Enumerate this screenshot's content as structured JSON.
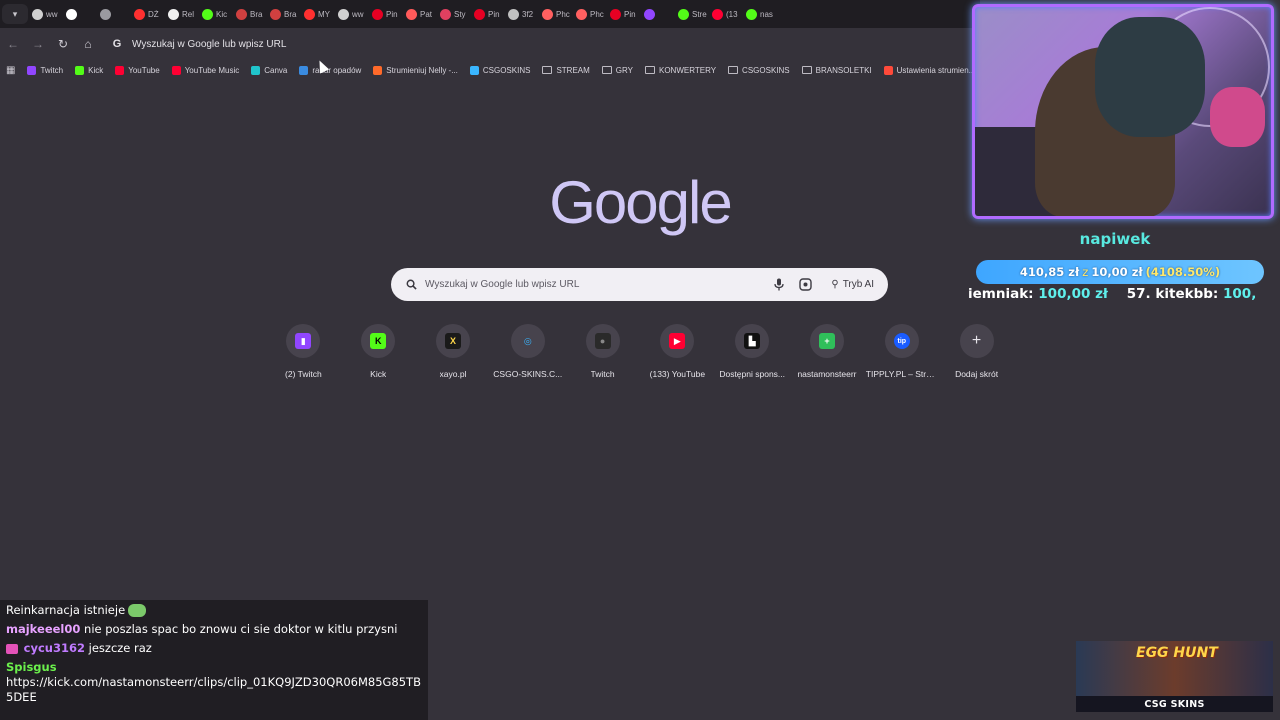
{
  "tabs": [
    {
      "label": "ww",
      "fav": "#d0d0d0"
    },
    {
      "label": "",
      "fav": "#ffffff"
    },
    {
      "label": "",
      "fav": "#9a9aa0"
    },
    {
      "label": "DŻ",
      "fav": "#ff3030"
    },
    {
      "label": "Rel",
      "fav": "#f0f0f0"
    },
    {
      "label": "Kic",
      "fav": "#53fc18"
    },
    {
      "label": "Bra",
      "fav": "#d04040"
    },
    {
      "label": "Bra",
      "fav": "#d04040"
    },
    {
      "label": "MY",
      "fav": "#ff3030"
    },
    {
      "label": "ww",
      "fav": "#d0d0d0"
    },
    {
      "label": "Pin",
      "fav": "#e60023"
    },
    {
      "label": "Pat",
      "fav": "#ff5a5a"
    },
    {
      "label": "Sty",
      "fav": "#e04060"
    },
    {
      "label": "Pin",
      "fav": "#e60023"
    },
    {
      "label": "3f2",
      "fav": "#c0c0c0"
    },
    {
      "label": "Phc",
      "fav": "#ff6060"
    },
    {
      "label": "Phc",
      "fav": "#ff6060"
    },
    {
      "label": "Pin",
      "fav": "#e60023"
    },
    {
      "label": "",
      "fav": "#9146ff"
    },
    {
      "label": "Stre",
      "fav": "#53fc18"
    },
    {
      "label": "(13",
      "fav": "#ff0033"
    },
    {
      "label": "nas",
      "fav": "#53fc18"
    }
  ],
  "toolbar": {
    "omnibox_text": "Wyszukaj w Google lub wpisz URL"
  },
  "bookmarks": [
    {
      "label": "Twitch",
      "color": "#9146ff",
      "folder": false
    },
    {
      "label": "Kick",
      "color": "#53fc18",
      "folder": false
    },
    {
      "label": "YouTube",
      "color": "#ff0033",
      "folder": false
    },
    {
      "label": "YouTube Music",
      "color": "#ff0033",
      "folder": false
    },
    {
      "label": "Canva",
      "color": "#20c4cb",
      "folder": false
    },
    {
      "label": "radar opadów",
      "color": "#3a8be0",
      "folder": false
    },
    {
      "label": "Strumieniuj Nelly -...",
      "color": "#ff6a2a",
      "folder": false
    },
    {
      "label": "CSGOSKINS",
      "color": "#3ab6ff",
      "folder": false
    },
    {
      "label": "STREAM",
      "color": "",
      "folder": true
    },
    {
      "label": "GRY",
      "color": "",
      "folder": true
    },
    {
      "label": "KONWERTERY",
      "color": "",
      "folder": true
    },
    {
      "label": "CSGOSKINS",
      "color": "",
      "folder": true
    },
    {
      "label": "BRANSOLETKI",
      "color": "",
      "folder": true
    },
    {
      "label": "Ustawienia strumien...",
      "color": "#ff4a3a",
      "folder": false
    }
  ],
  "ntp": {
    "logo": "Google",
    "search_placeholder": "Wyszukaj w Google lub wpisz URL",
    "ai_mode_label": "Tryb AI",
    "shortcuts": [
      {
        "label": "(2) Twitch",
        "icon": "twitch-icon",
        "glyph": "▮",
        "bg": "#9146ff",
        "fg": "#ffffff"
      },
      {
        "label": "Kick",
        "icon": "kick-icon",
        "glyph": "K",
        "bg": "#53fc18",
        "fg": "#000000"
      },
      {
        "label": "xayo.pl",
        "icon": "xayo-icon",
        "glyph": "X",
        "bg": "#1a1a1a",
        "fg": "#ffd84a"
      },
      {
        "label": "CSGO-SKINS.C...",
        "icon": "csgoskins-icon",
        "glyph": "◎",
        "bg": "transparent",
        "fg": "#3ab6ff"
      },
      {
        "label": "Twitch",
        "icon": "twitch-avatar-icon",
        "glyph": "●",
        "bg": "#2a2a2a",
        "fg": "#888888"
      },
      {
        "label": "(133) YouTube",
        "icon": "youtube-icon",
        "glyph": "▶",
        "bg": "#ff0033",
        "fg": "#ffffff"
      },
      {
        "label": "Dostępni spons...",
        "icon": "sponsors-icon",
        "glyph": "▙",
        "bg": "#111111",
        "fg": "#ffffff"
      },
      {
        "label": "nastamonsteerr",
        "icon": "sheets-icon",
        "glyph": "+",
        "bg": "#2fbf5a",
        "fg": "#ffffff"
      },
      {
        "label": "TIPPLY.PL – Stre...",
        "icon": "tipply-icon",
        "glyph": "tip",
        "bg": "#1a5cff",
        "fg": "#ffffff"
      },
      {
        "label": "Dodaj skrót",
        "icon": "add-shortcut-icon",
        "glyph": "+",
        "bg": "transparent",
        "fg": "#e6e4ea"
      }
    ]
  },
  "overlay": {
    "tip_name": "napiwek",
    "goal": {
      "current": "410,85 zł",
      "sep": "z",
      "target": "10,00 zł",
      "percent": "(4108.50%)"
    },
    "ticker": [
      {
        "name": "iemniak:",
        "amount": "100,00 zł"
      },
      {
        "name": "57. kitekbb:",
        "amount": "100,"
      }
    ]
  },
  "chat": {
    "lines": [
      {
        "user": "",
        "text": "Reinkarnacja istnieje"
      },
      {
        "user": "majkeeel00",
        "text": "nie poszlas spac bo znowu ci sie doktor w kitlu przysni"
      },
      {
        "user": "cycu3162",
        "text": "jeszcze raz"
      },
      {
        "user": "Spisgus",
        "text": ""
      },
      {
        "user": "",
        "text": "https://kick.com/nastamonsteerr/clips/clip_01KQ9JZD30QR06M85G85TB5DEE"
      }
    ]
  },
  "promo": {
    "title": "EGG HUNT",
    "brand": "CSG SKINS"
  }
}
